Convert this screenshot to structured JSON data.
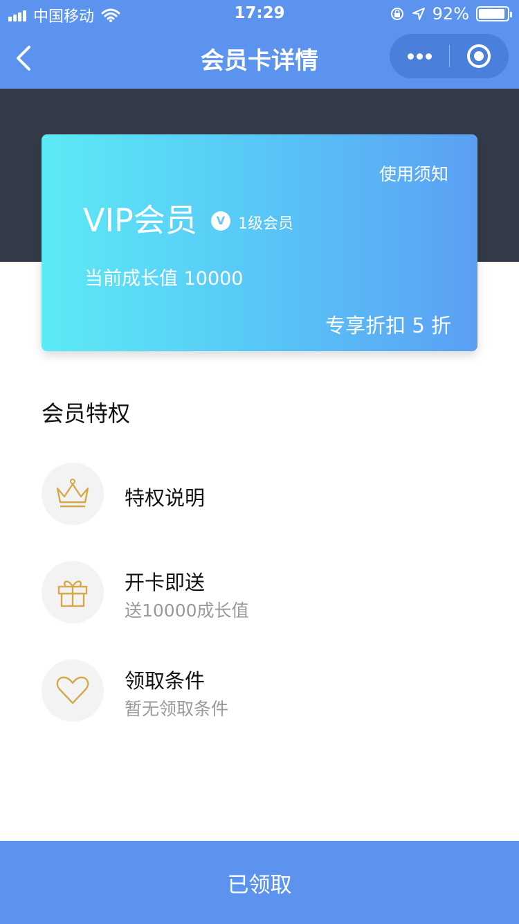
{
  "status_bar": {
    "carrier": "中国移动",
    "time": "17:29",
    "battery": "92%",
    "battery_level": 0.92
  },
  "nav": {
    "title": "会员卡详情"
  },
  "card": {
    "notice": "使用须知",
    "title": "VIP会员",
    "badge": "V",
    "level": "1级会员",
    "growth": "当前成长值 10000",
    "discount": "专享折扣 5 折"
  },
  "section": {
    "title": "会员特权"
  },
  "perks": [
    {
      "icon": "crown-icon",
      "title": "特权说明",
      "subtitle": ""
    },
    {
      "icon": "gift-icon",
      "title": "开卡即送",
      "subtitle": "送10000成长值"
    },
    {
      "icon": "heart-icon",
      "title": "领取条件",
      "subtitle": "暂无领取条件"
    }
  ],
  "bottom_button": {
    "label": "已领取"
  },
  "colors": {
    "primary": "#5b93ef",
    "dark_band": "#343b48",
    "icon_gold": "#d4a94a"
  }
}
